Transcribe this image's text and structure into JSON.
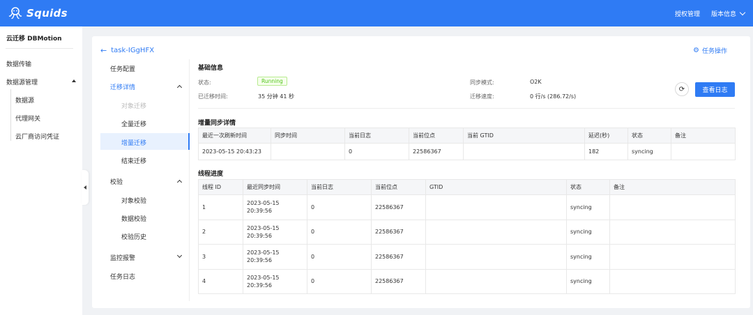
{
  "header": {
    "brand": "Squids",
    "auth_label": "授权管理",
    "version_label": "版本信息"
  },
  "sidebar": {
    "title": "云迁移 DBMotion",
    "items": [
      {
        "label": "数据传输"
      },
      {
        "label": "数据源管理"
      }
    ],
    "subitems": [
      {
        "label": "数据源"
      },
      {
        "label": "代理网关"
      },
      {
        "label": "云厂商访问凭证"
      }
    ]
  },
  "task": {
    "back_label": "task-IGgHFX",
    "ops_label": "任务操作"
  },
  "subnav": {
    "task_config": "任务配置",
    "migration_detail": "迁移详情",
    "object_migration": "对象迁移",
    "full_migration": "全量迁移",
    "incremental_migration": "增量迁移",
    "end_migration": "结束迁移",
    "verify": "校验",
    "object_verify": "对象校验",
    "data_verify": "数据校验",
    "verify_history": "校验历史",
    "monitor_alert": "监控报警",
    "task_log": "任务日志"
  },
  "basic": {
    "title": "基础信息",
    "status_label": "状态:",
    "status_value": "Running",
    "elapsed_label": "已迁移时间:",
    "elapsed_value": "35 分钟 41 秒",
    "sync_mode_label": "同步模式:",
    "sync_mode_value": "O2K",
    "speed_label": "迁移速度:",
    "speed_value": "0 行/s (286.72/s)",
    "view_log_label": "查看日志"
  },
  "incr": {
    "title": "增量同步详情",
    "columns": [
      "最近一次刷新时间",
      "同步时间",
      "当前日志",
      "当前位点",
      "当前 GTID",
      "延迟(秒)",
      "状态",
      "备注"
    ],
    "row": [
      "2023-05-15 20:43:23",
      "",
      "0",
      "22586367",
      "",
      "182",
      "syncing",
      ""
    ]
  },
  "threads": {
    "title": "线程进度",
    "columns": [
      "线程 ID",
      "最近同步时间",
      "当前日志",
      "当前位点",
      "GTID",
      "状态",
      "备注"
    ],
    "rows": [
      {
        "id": "1",
        "date": "2023-05-15",
        "time": "20:39:56",
        "log": "0",
        "pos": "22586367",
        "gtid": "",
        "status": "syncing",
        "note": ""
      },
      {
        "id": "2",
        "date": "2023-05-15",
        "time": "20:39:56",
        "log": "0",
        "pos": "22586367",
        "gtid": "",
        "status": "syncing",
        "note": ""
      },
      {
        "id": "3",
        "date": "2023-05-15",
        "time": "20:39:56",
        "log": "0",
        "pos": "22586367",
        "gtid": "",
        "status": "syncing",
        "note": ""
      },
      {
        "id": "4",
        "date": "2023-05-15",
        "time": "20:39:56",
        "log": "0",
        "pos": "22586367",
        "gtid": "",
        "status": "syncing",
        "note": ""
      }
    ]
  }
}
